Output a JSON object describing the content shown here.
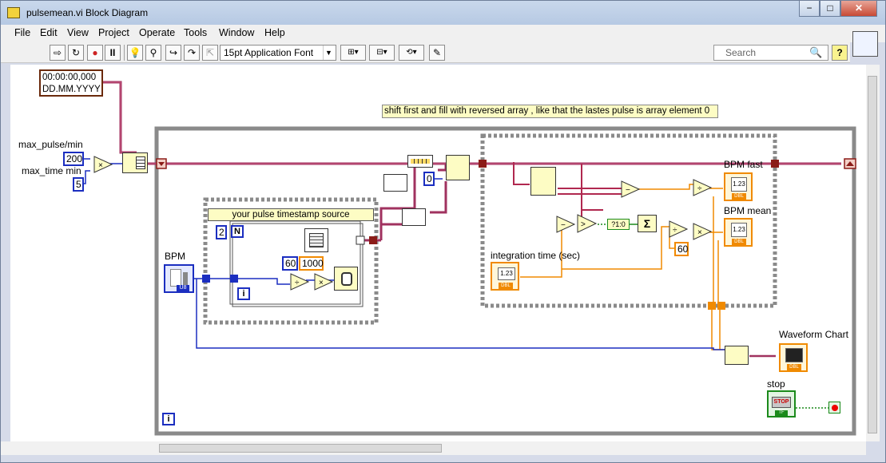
{
  "window": {
    "title": "pulsemean.vi Block Diagram",
    "minimize_label": "−",
    "maximize_label": "□",
    "close_label": "✕"
  },
  "menu": [
    "File",
    "Edit",
    "View",
    "Project",
    "Operate",
    "Tools",
    "Window",
    "Help"
  ],
  "toolbar": {
    "run_icon": "run-arrow-icon",
    "font": "15pt Application Font",
    "search_placeholder": "Search",
    "help_label": "?"
  },
  "diagram": {
    "timestamp_line1": "00:00:00,000",
    "timestamp_line2": "DD.MM.YYYY",
    "max_pulse_label": "max_pulse/min",
    "max_pulse_value": "200",
    "max_time_label": "max_time min",
    "max_time_value": "5",
    "comment": "shift first and fill with reversed array , like that the lastes pulse is array element 0",
    "bpm_label": "BPM",
    "bpm_terminal": "U8",
    "subvi_title": "your pulse timestamp source",
    "loop_count_n": "N",
    "loop_count_value": "2",
    "const_60_a": "60",
    "const_1000": "1000",
    "loop_index_i": "i",
    "const_0": "0",
    "bpm_fast_label": "BPM fast",
    "bpm_mean_label": "BPM mean",
    "indicator_value": "1.23",
    "dbl": "DBL",
    "integration_label": "integration time (sec)",
    "const_60_b": "60",
    "waveform_label": "Waveform Chart",
    "stop_label": "stop",
    "stop_button": "STOP",
    "stop_tf": "TF",
    "while_i": "i",
    "shift_node": "?1:0",
    "sigma": "Σ"
  }
}
